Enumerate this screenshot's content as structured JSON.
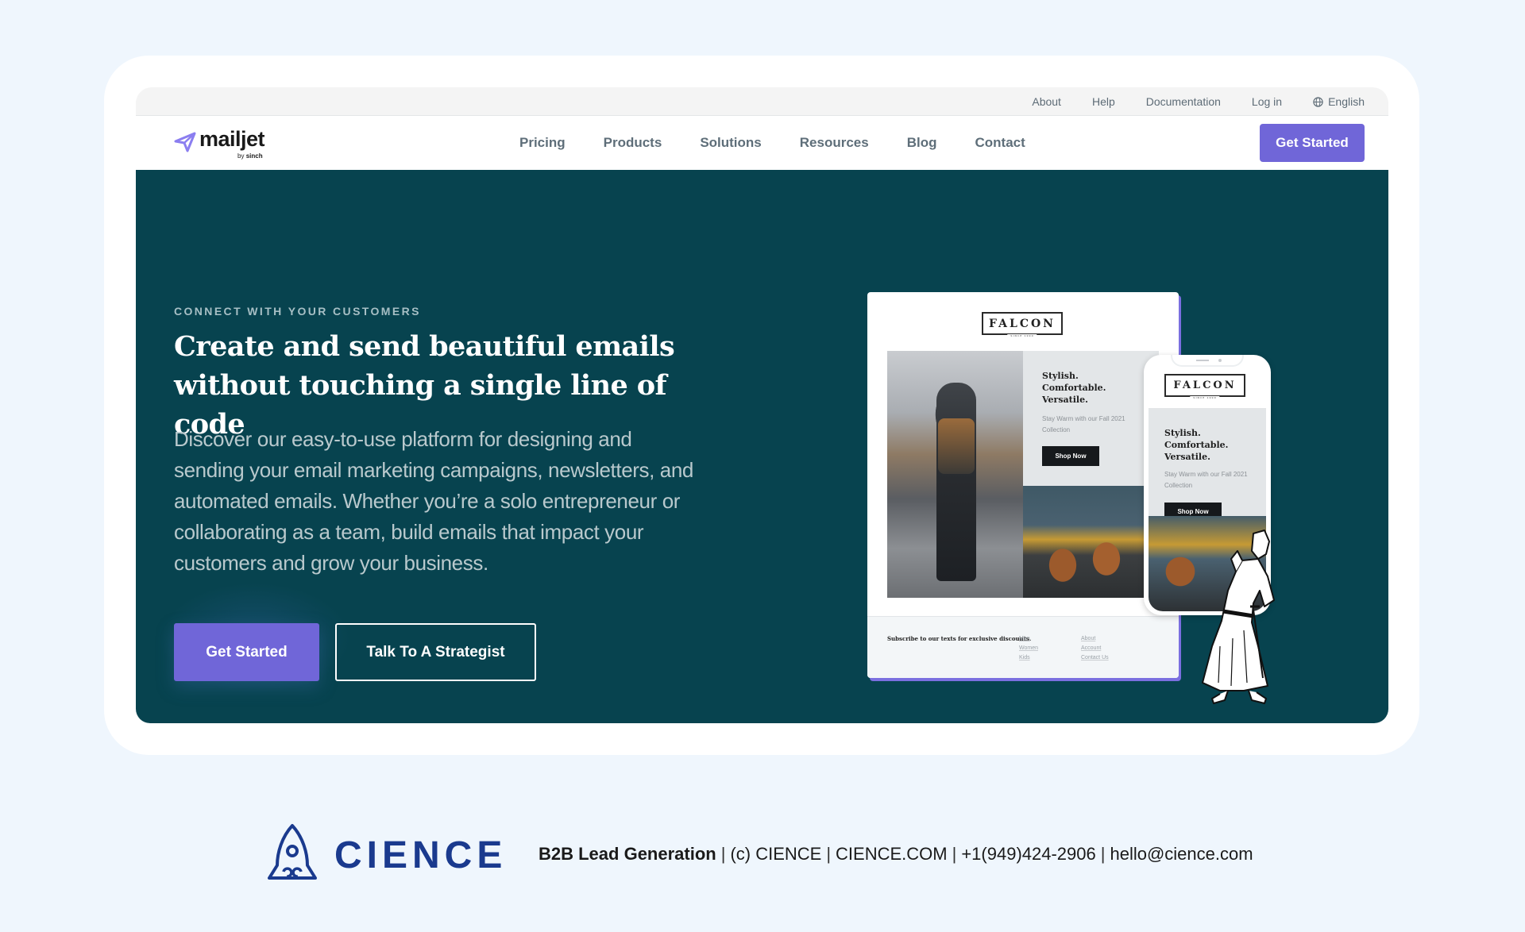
{
  "topbar": {
    "links": [
      "About",
      "Help",
      "Documentation",
      "Log in"
    ],
    "language": "English"
  },
  "brand": {
    "name": "mailjet",
    "by_prefix": "by",
    "by_name": "sinch",
    "accent_color": "#7066d8"
  },
  "nav": {
    "items": [
      "Pricing",
      "Products",
      "Solutions",
      "Resources",
      "Blog",
      "Contact"
    ],
    "cta_label": "Get Started"
  },
  "hero": {
    "background_color": "#07434f",
    "eyebrow": "CONNECT WITH YOUR CUSTOMERS",
    "headline_line1": "Create and send beautiful emails",
    "headline_line2": "without touching a single line of code",
    "body": "Discover our easy-to-use platform for designing and sending your email marketing campaigns, newsletters, and automated emails. Whether you’re a solo entrepreneur or collaborating as a team, build emails that impact your customers and grow your business.",
    "primary_cta": "Get Started",
    "secondary_cta": "Talk To A Strategist"
  },
  "email_mockup": {
    "brand": "FALCON",
    "brand_tagline": "SINCE 1990",
    "title_lines": [
      "Stylish.",
      "Comfortable.",
      "Versatile."
    ],
    "subtitle": "Stay Warm with our Fall 2021 Collection",
    "button": "Shop Now",
    "footer_text": "Subscribe to our texts for exclusive discounts.",
    "footer_col1": [
      "Men",
      "Women",
      "Kids"
    ],
    "footer_col2": [
      "About",
      "Account",
      "Contact Us"
    ]
  },
  "footer": {
    "company": "CIENCE",
    "tagline": "B2B Lead Generation",
    "copyright": "(c) CIENCE",
    "website": "CIENCE.COM",
    "phone": "+1(949)424-2906",
    "email": "hello@cience.com",
    "brand_color": "#1a3a8e"
  }
}
